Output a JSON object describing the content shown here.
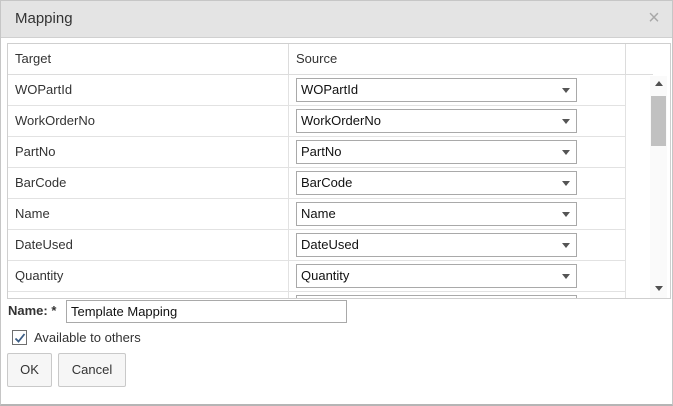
{
  "dialog": {
    "title": "Mapping",
    "close_icon": "close-icon"
  },
  "grid": {
    "headers": {
      "target": "Target",
      "source": "Source"
    },
    "rows": [
      {
        "target": "WOPartId",
        "source": "WOPartId"
      },
      {
        "target": "WorkOrderNo",
        "source": "WorkOrderNo"
      },
      {
        "target": "PartNo",
        "source": "PartNo"
      },
      {
        "target": "BarCode",
        "source": "BarCode"
      },
      {
        "target": "Name",
        "source": "Name"
      },
      {
        "target": "DateUsed",
        "source": "DateUsed"
      },
      {
        "target": "Quantity",
        "source": "Quantity"
      },
      {
        "target": "",
        "source": ""
      }
    ]
  },
  "form": {
    "name_label": "Name: *",
    "name_value": "Template Mapping",
    "available_label": "Available to others",
    "available_checked": true
  },
  "buttons": {
    "ok": "OK",
    "cancel": "Cancel"
  }
}
